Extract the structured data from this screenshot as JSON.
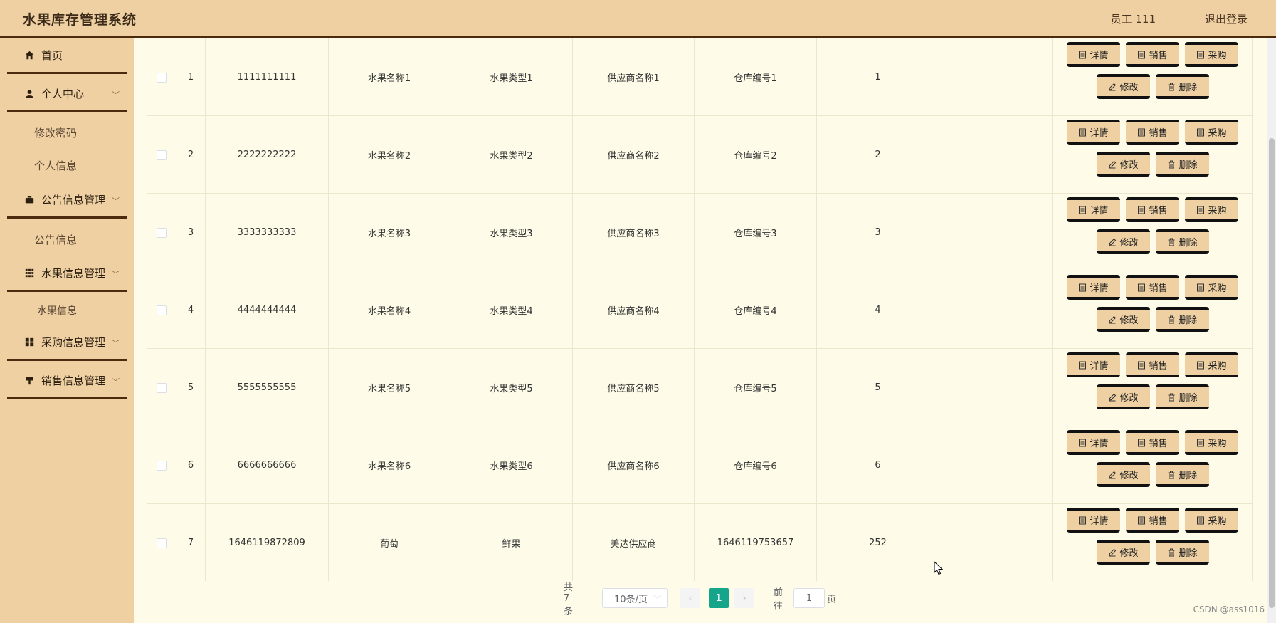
{
  "header": {
    "title": "水果库存管理系统",
    "user": "员工 111",
    "logout": "退出登录"
  },
  "sidebar": {
    "home": "首页",
    "personal": "个人中心",
    "change_password": "修改密码",
    "personal_info": "个人信息",
    "notice_mgmt": "公告信息管理",
    "notice_info": "公告信息",
    "fruit_mgmt": "水果信息管理",
    "fruit_info": "水果信息",
    "purchase_mgmt": "采购信息管理",
    "sales_mgmt": "销售信息管理"
  },
  "actions": {
    "detail": "详情",
    "sell": "销售",
    "purchase": "采购",
    "edit": "修改",
    "delete": "删除"
  },
  "rows": [
    {
      "index": "1",
      "code": "1111111111",
      "name": "水果名称1",
      "type": "水果类型1",
      "supplier": "供应商名称1",
      "warehouse": "仓库编号1",
      "qty": "1"
    },
    {
      "index": "2",
      "code": "2222222222",
      "name": "水果名称2",
      "type": "水果类型2",
      "supplier": "供应商名称2",
      "warehouse": "仓库编号2",
      "qty": "2"
    },
    {
      "index": "3",
      "code": "3333333333",
      "name": "水果名称3",
      "type": "水果类型3",
      "supplier": "供应商名称3",
      "warehouse": "仓库编号3",
      "qty": "3"
    },
    {
      "index": "4",
      "code": "4444444444",
      "name": "水果名称4",
      "type": "水果类型4",
      "supplier": "供应商名称4",
      "warehouse": "仓库编号4",
      "qty": "4"
    },
    {
      "index": "5",
      "code": "5555555555",
      "name": "水果名称5",
      "type": "水果类型5",
      "supplier": "供应商名称5",
      "warehouse": "仓库编号5",
      "qty": "5"
    },
    {
      "index": "6",
      "code": "6666666666",
      "name": "水果名称6",
      "type": "水果类型6",
      "supplier": "供应商名称6",
      "warehouse": "仓库编号6",
      "qty": "6"
    },
    {
      "index": "7",
      "code": "1646119872809",
      "name": "葡萄",
      "type": "鲜果",
      "supplier": "美达供应商",
      "warehouse": "1646119753657",
      "qty": "252"
    }
  ],
  "pagination": {
    "total": "共 7 条",
    "page_size": "10条/页",
    "current": "1",
    "goto_prefix": "前往",
    "goto_value": "1",
    "goto_suffix": "页"
  },
  "watermark": "CSDN @ass1016",
  "colors": {
    "header_bg": "#eed0a3",
    "accent_dark": "#4a2b0d",
    "table_bg": "#fefce8",
    "current_page": "#14a58a"
  },
  "icons": {
    "home": "home-icon",
    "personal": "user-icon",
    "notice": "briefcase-icon",
    "fruit": "grid-icon",
    "purchase": "apps-icon",
    "sales": "cup-icon",
    "detail": "document-icon",
    "edit": "pencil-icon",
    "delete": "trash-icon"
  }
}
